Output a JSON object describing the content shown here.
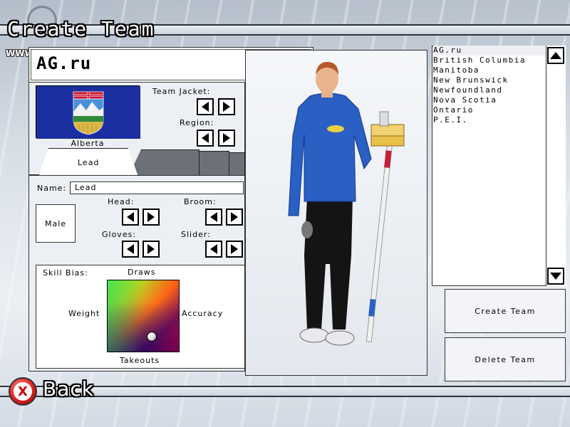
{
  "header": {
    "title": "Create Team",
    "site_url": "WWW.AG.RU"
  },
  "team": {
    "name": "AG.ru",
    "flag_label": "Alberta",
    "team_jacket_label": "Team Jacket:",
    "region_label": "Region:"
  },
  "tabs": [
    {
      "label": "Lead",
      "active": true
    },
    {
      "label": "",
      "active": false
    },
    {
      "label": "",
      "active": false
    },
    {
      "label": "",
      "active": false
    }
  ],
  "player": {
    "name_label": "Name:",
    "name_value": "Lead",
    "gender": "Male",
    "head_label": "Head:",
    "broom_label": "Broom:",
    "gloves_label": "Gloves:",
    "slider_label": "Slider:"
  },
  "skill": {
    "label": "Skill Bias:",
    "top": "Draws",
    "left": "Weight",
    "right": "Accuracy",
    "bottom": "Takeouts",
    "bias_x": 0.62,
    "bias_y": 0.78
  },
  "team_list": {
    "items": [
      "AG.ru",
      "British Columbia",
      "Manitoba",
      "New Brunswick",
      "Newfoundland",
      "Nova Scotia",
      "Ontario",
      "P.E.I."
    ],
    "selected_index": 0
  },
  "actions": {
    "create": "Create Team",
    "delete": "Delete Team"
  },
  "footer": {
    "back": "Back",
    "back_button_glyph": "X"
  },
  "colors": {
    "flag_blue": "#1b2fa0",
    "jacket_blue": "#2a5fc4",
    "x_button_red": "#e02020"
  }
}
